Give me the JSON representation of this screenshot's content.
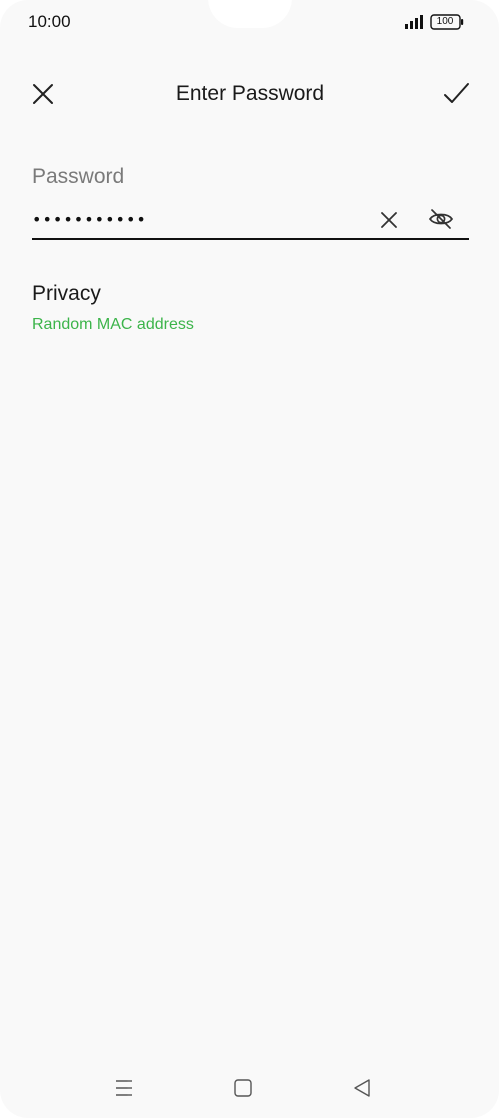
{
  "status_bar": {
    "time": "10:00",
    "battery": "100",
    "icons": [
      "signal-icon",
      "battery-icon"
    ]
  },
  "header": {
    "title": "Enter Password",
    "icons": [
      "close-icon",
      "check-icon"
    ]
  },
  "password_field": {
    "label": "Password",
    "value": "•••••••••••",
    "icons": [
      "clear-icon",
      "visibility-off-icon"
    ]
  },
  "privacy": {
    "title": "Privacy",
    "value": "Random MAC address"
  },
  "nav_bar": {
    "icons": [
      "menu-icon",
      "home-icon",
      "back-icon"
    ]
  },
  "colors": {
    "background": "#f9f9f9",
    "accent_green": "#3cb44a",
    "text_primary": "#1a1a1a",
    "text_secondary": "#7a7a7a"
  }
}
